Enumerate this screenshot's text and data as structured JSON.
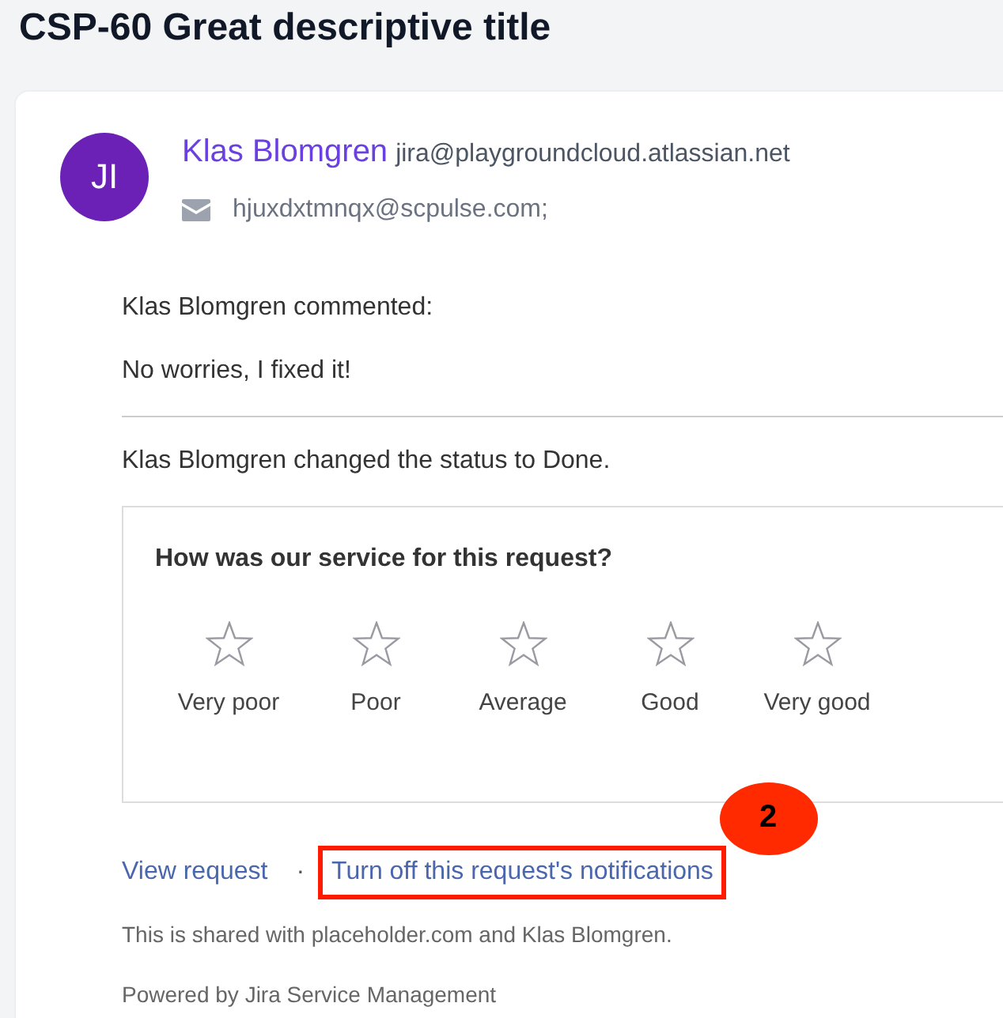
{
  "page": {
    "title": "CSP-60 Great descriptive title"
  },
  "message": {
    "avatar_initials": "JI",
    "sender_name": "Klas Blomgren",
    "sender_email": "jira@playgroundcloud.atlassian.net",
    "recipient": "hjuxdxtmnqx@scpulse.com;"
  },
  "activity": [
    {
      "kind": "comment",
      "heading": "Klas Blomgren commented:",
      "body": "No worries, I fixed it!"
    },
    {
      "kind": "status",
      "text": "Klas Blomgren changed the status to Done."
    }
  ],
  "survey": {
    "question": "How was our service for this request?",
    "stars": 0,
    "options": [
      "Very poor",
      "Poor",
      "Average",
      "Good",
      "Very good"
    ]
  },
  "links": [
    {
      "label": "View request",
      "highlighted": false
    },
    {
      "label": "Turn off this request's notifications",
      "highlighted": true,
      "badge": "2"
    }
  ],
  "link_separator": "·",
  "footer": [
    "This is shared with placeholder.com and Klas Blomgren.",
    "Powered by Jira Service Management"
  ]
}
